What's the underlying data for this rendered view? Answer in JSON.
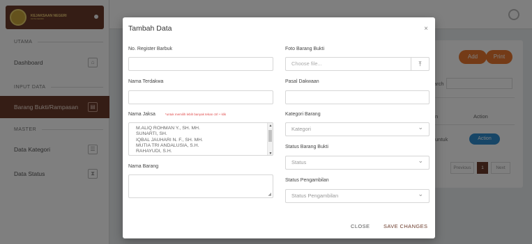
{
  "brand": {
    "title": "KEJAKSAAN NEGERI",
    "subtitle": "KOTA KEDIRI"
  },
  "sidebar": {
    "sections": [
      "UTAMA",
      "INPUT DATA",
      "MASTER"
    ],
    "items": [
      {
        "label": "Dashboard",
        "icon": "home-icon"
      },
      {
        "label": "Barang Bukti/Rampasan",
        "icon": "document-icon",
        "active": true
      },
      {
        "label": "Data Kategori",
        "icon": "list-icon"
      },
      {
        "label": "Data Status",
        "icon": "hourglass-icon"
      }
    ]
  },
  "background": {
    "add_label": "Add",
    "print_label": "Print",
    "search_label": "arch",
    "col_fragment": "n",
    "action_header": "Action",
    "row_fragment": "untuk",
    "action_button": "Action",
    "pager": {
      "previous": "Previous",
      "page": "1",
      "next": "Next"
    }
  },
  "modal": {
    "title": "Tambah Data",
    "close_icon": "×",
    "labels": {
      "no_register": "No. Register Barbuk",
      "foto": "Foto Barang Bukti",
      "nama_terdakwa": "Nama Terdakwa",
      "pasal": "Pasal Dakwaan",
      "nama_jaksa": "Nama Jaksa",
      "jaksa_hint": "*untuk memilih lebih banyak tekan ctrl + klik",
      "kategori": "Kategori Barang",
      "status_bukti": "Status Barang Bukti",
      "nama_barang": "Nama Barang",
      "status_pengambilan": "Status Pengambilan"
    },
    "file_placeholder": "Choose file...",
    "jaksa_options": [
      "M.ALIQ ROHMAN Y., SH. MH.",
      "SUNARTI, SH.",
      "IQBAL JAUHARI N. F., SH. MH.",
      "MUTIA TRI ANDALUSIA, S.H.",
      "RAHAYUDI, S.H."
    ],
    "kategori_selected": "Kategori",
    "status_selected": "Status",
    "pengambilan_selected": "Status Pengambilan",
    "close_button": "CLOSE",
    "save_button": "SAVE CHANGES"
  },
  "colors": {
    "brand": "#6b3a2a",
    "accent": "#e8772e",
    "primary": "#2f8ccf",
    "save": "#6b3a2a"
  }
}
